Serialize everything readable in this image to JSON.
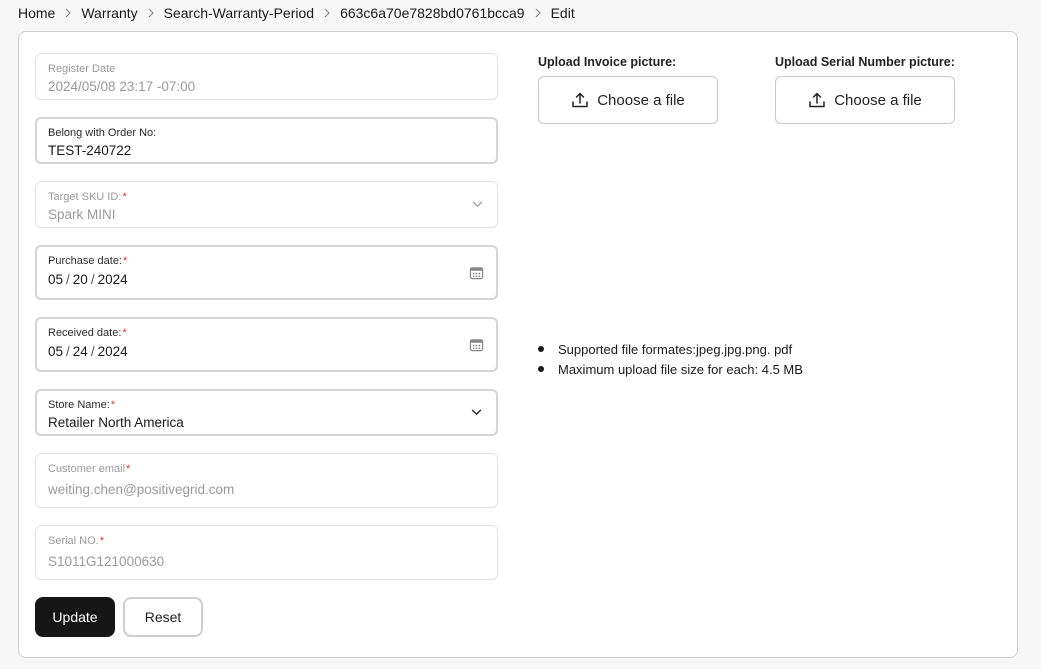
{
  "breadcrumb": {
    "items": [
      "Home",
      "Warranty",
      "Search-Warranty-Period",
      "663c6a70e7828bd0761bcca9",
      "Edit"
    ]
  },
  "form": {
    "register_date": {
      "label": "Register Date",
      "value": "2024/05/08 23:17 -07:00"
    },
    "order_no": {
      "label": "Belong with Order No:",
      "value": "TEST-240722"
    },
    "target_sku": {
      "label": "Target SKU ID:",
      "value": "Spark MINI"
    },
    "purchase_date": {
      "label": "Purchase date:",
      "month": "05",
      "day": "20",
      "year": "2024"
    },
    "received_date": {
      "label": "Received date:",
      "month": "05",
      "day": "24",
      "year": "2024"
    },
    "store_name": {
      "label": "Store Name:",
      "value": "Retailer North America"
    },
    "customer_email": {
      "label": "Customer email",
      "value": "weiting.chen@positivegrid.com"
    },
    "serial_no": {
      "label": "Serial NO.",
      "value": "S1011G121000630"
    },
    "required_mark": "*"
  },
  "uploads": {
    "invoice": {
      "label": "Upload Invoice picture:",
      "button": "Choose a file"
    },
    "serial": {
      "label": "Upload Serial Number picture:",
      "button": "Choose a file"
    },
    "notes": [
      "Supported file formates:jpeg.jpg.png. pdf",
      "Maximum upload file size for each: 4.5 MB"
    ]
  },
  "actions": {
    "update": "Update",
    "reset": "Reset"
  },
  "colors": {
    "primary_button": "#161616",
    "required": "#e0342b"
  },
  "icons": {
    "breadcrumb_separator": "chevron-right-icon",
    "dropdown": "chevron-down-icon",
    "calendar": "calendar-icon",
    "upload": "upload-icon"
  }
}
